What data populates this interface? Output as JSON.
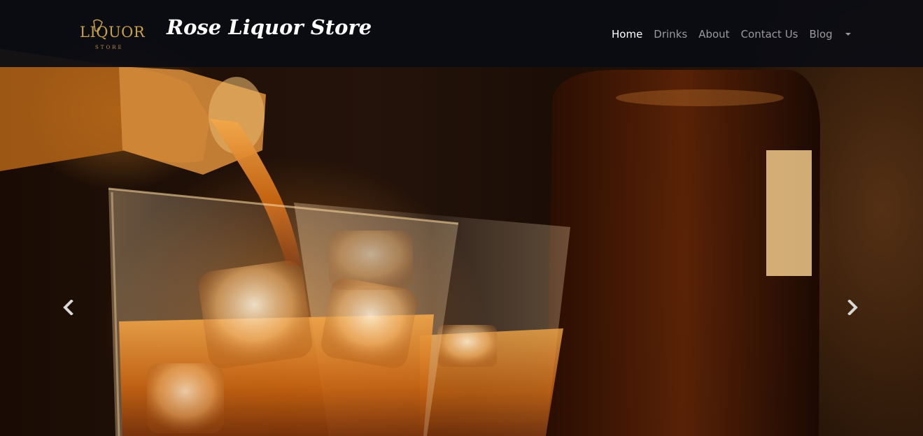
{
  "header": {
    "logo": {
      "text": "LIQUOR",
      "subtext": "STORE"
    },
    "brand_title": "Rose Liquor Store",
    "nav": {
      "items": [
        {
          "label": "Home",
          "active": true
        },
        {
          "label": "Drinks",
          "active": false
        },
        {
          "label": "About",
          "active": false
        },
        {
          "label": "Contact Us",
          "active": false
        },
        {
          "label": "Blog",
          "active": false
        }
      ],
      "dropdown_icon": "caret-down-icon"
    }
  },
  "carousel": {
    "prev_icon": "chevron-left-icon",
    "next_icon": "chevron-right-icon"
  },
  "colors": {
    "navbar_bg": "#0a0c14",
    "logo_gold": "#c9a14a",
    "nav_active": "#ffffff",
    "nav_inactive": "#9a9a9a",
    "whisky_amber": "#e08a2a"
  }
}
